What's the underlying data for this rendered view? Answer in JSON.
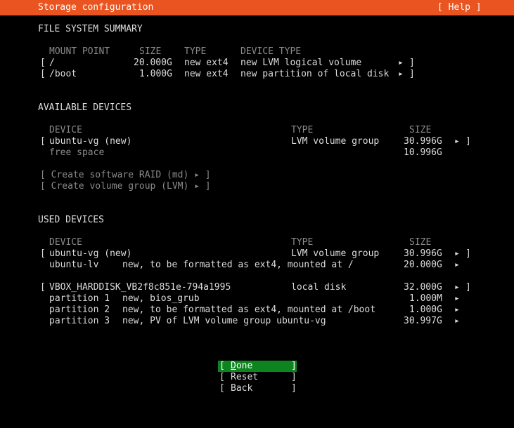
{
  "header": {
    "title": "Storage configuration",
    "help": "[ Help ]"
  },
  "fs_summary": {
    "heading": "FILE SYSTEM SUMMARY",
    "columns": {
      "mount": "MOUNT POINT",
      "size": "SIZE",
      "type": "TYPE",
      "device_type": "DEVICE TYPE"
    },
    "rows": [
      {
        "mount": "/",
        "size": "20.000G",
        "type": "new ext4",
        "device_type": "new LVM logical volume"
      },
      {
        "mount": "/boot",
        "size": "1.000G",
        "type": "new ext4",
        "device_type": "new partition of local disk"
      }
    ]
  },
  "available": {
    "heading": "AVAILABLE DEVICES",
    "columns": {
      "device": "DEVICE",
      "type": "TYPE",
      "size": "SIZE"
    },
    "device": {
      "name": "ubuntu-vg (new)",
      "type": "LVM volume group",
      "size": "30.996G"
    },
    "free_space": {
      "label": "free space",
      "size": "10.996G"
    },
    "create_raid": "[ Create software RAID (md) ▸ ]",
    "create_vg": "[ Create volume group (LVM) ▸ ]"
  },
  "used": {
    "heading": "USED DEVICES",
    "columns": {
      "device": "DEVICE",
      "type": "TYPE",
      "size": "SIZE"
    },
    "vg": {
      "name": "ubuntu-vg (new)",
      "type": "LVM volume group",
      "size": "30.996G"
    },
    "lv": {
      "name": "ubuntu-lv",
      "desc": "new, to be formatted as ext4, mounted at /",
      "size": "20.000G"
    },
    "disk": {
      "name": "VBOX_HARDDISK_VB2f8c851e-794a1995",
      "type": "local disk",
      "size": "32.000G"
    },
    "partitions": [
      {
        "name": "partition 1",
        "desc": "new, bios_grub",
        "size": "1.000M"
      },
      {
        "name": "partition 2",
        "desc": "new, to be formatted as ext4, mounted at /boot",
        "size": "1.000G"
      },
      {
        "name": "partition 3",
        "desc": "new, PV of LVM volume group ubuntu-vg",
        "size": "30.997G"
      }
    ]
  },
  "buttons": {
    "done_rest": "one",
    "done_u": "D",
    "reset": "Reset",
    "back": "Back"
  },
  "glyphs": {
    "open": "[",
    "close": "]",
    "arrow": "▸"
  },
  "colors": {
    "header_bg": "#e95420",
    "focus_bg": "#0e8420",
    "dim_text": "#8a8a8a"
  }
}
